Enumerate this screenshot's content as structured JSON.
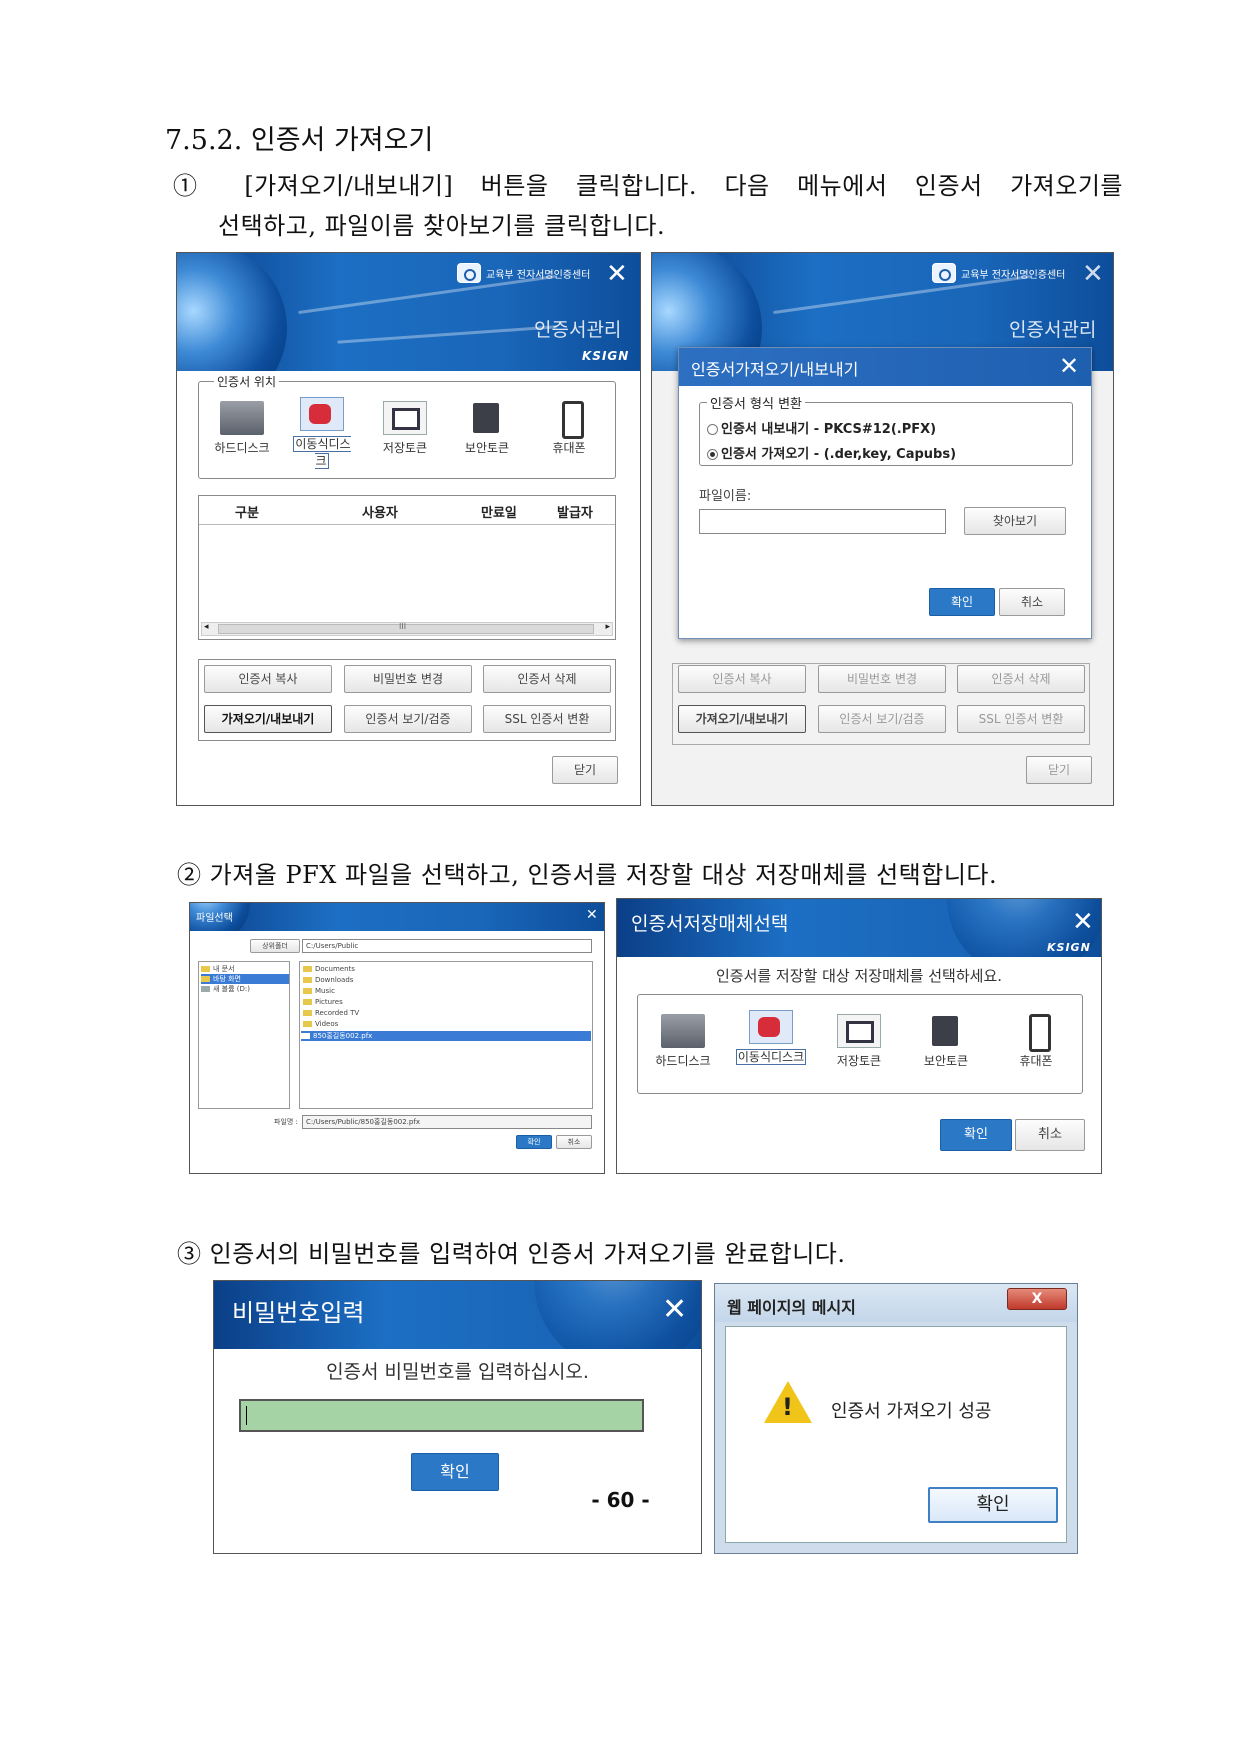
{
  "section_heading": "7.5.2. 인증서 가져오기",
  "step1": {
    "line1": "① [가져오기/내보내기] 버튼을 클릭합니다. 다음 메뉴에서 인증서 가져오기를",
    "line2": "선택하고, 파일이름 찾아보기를 클릭합니다."
  },
  "step2": "② 가져올 PFX 파일을 선택하고, 인증서를 저장할 대상 저장매체를 선택합니다.",
  "step3": "③ 인증서의 비밀번호를 입력하여 인증서 가져오기를 완료합니다.",
  "page_number": "- 60 -",
  "cert_manager": {
    "brand": "교육부 전자서명인증센터",
    "title": "인증서관리",
    "ksign": "KSIGN",
    "location_legend": "인증서 위치",
    "media": [
      "하드디스크",
      "이동식디스크",
      "저장토큰",
      "보안토큰",
      "휴대폰"
    ],
    "columns": [
      "구분",
      "사용자",
      "만료일",
      "발급자"
    ],
    "scroll_mark": "III",
    "buttons": [
      "인증서 복사",
      "비밀번호 변경",
      "인증서 삭제",
      "가져오기/내보내기",
      "인증서 보기/검증",
      "SSL 인증서 변환"
    ],
    "close_label": "닫기"
  },
  "import_dialog": {
    "title": "인증서가져오기/내보내기",
    "format_legend": "인증서 형식 변환",
    "option_export": "인증서 내보내기 - PKCS#12(.PFX)",
    "option_import": "인증서 가져오기 - (.der,key, Capubs)",
    "filename_label": "파일이름:",
    "browse_label": "찾아보기",
    "ok_label": "확인",
    "cancel_label": "취소"
  },
  "file_dialog": {
    "title": "파일선택",
    "up_label": "상위폴더",
    "path": "C:/Users/Public",
    "tree": [
      "내 문서",
      "바탕 화면",
      "새 볼륨 (D:)"
    ],
    "files": [
      "Documents",
      "Downloads",
      "Music",
      "Pictures",
      "Recorded TV",
      "Videos",
      "850홍길동002.pfx"
    ],
    "filename_label": "파일명 :",
    "filename_value": "C:/Users/Public/850홍길동002.pfx",
    "ok_label": "확인",
    "cancel_label": "취소"
  },
  "storage_dialog": {
    "title": "인증서저장매체선택",
    "prompt": "인증서를 저장할 대상 저장매체를 선택하세요.",
    "media": [
      "하드디스크",
      "이동식디스크",
      "저장토큰",
      "보안토큰",
      "휴대폰"
    ],
    "ok_label": "확인",
    "cancel_label": "취소"
  },
  "password_dialog": {
    "title": "비밀번호입력",
    "prompt": "인증서 비밀번호를 입력하십시오.",
    "ok_label": "확인"
  },
  "message_box": {
    "title": "웹 페이지의 메시지",
    "message": "인증서 가져오기 성공",
    "ok_label": "확인",
    "close_label": "X"
  }
}
